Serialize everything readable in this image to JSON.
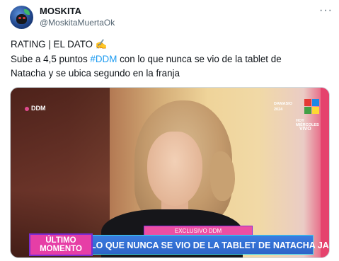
{
  "author": {
    "name": "MOSKITA",
    "handle": "@MoskitaMuertaOk"
  },
  "tweet": {
    "line1": "RATING | EL DATO ✍️",
    "line2_pre": "Sube a 4,5 puntos ",
    "hashtag": "#DDM",
    "line2_post": " con lo que nunca se vio de la tablet de",
    "line3": "Natacha y se ubica segundo en la franja"
  },
  "media": {
    "channel_bug": "DDM",
    "network_text_1": "DAMASIO",
    "network_text_2": "2024",
    "network_text_3": "HOY MIÉRCOLES",
    "network_text_4": "VIVO",
    "exclusivo": "EXCLUSIVO DDM",
    "ultimo_1": "ÚLTIMO",
    "ultimo_2": "MOMENTO",
    "headline": "LO QUE NUNCA SE VIO DE LA TABLET DE NATACHA JAITT"
  },
  "more_glyph": "···",
  "colors": {
    "link": "#1d9bf0",
    "secondary_text": "#536471",
    "banner_blue": "#2e64c7",
    "banner_pink": "#e63ea6"
  }
}
